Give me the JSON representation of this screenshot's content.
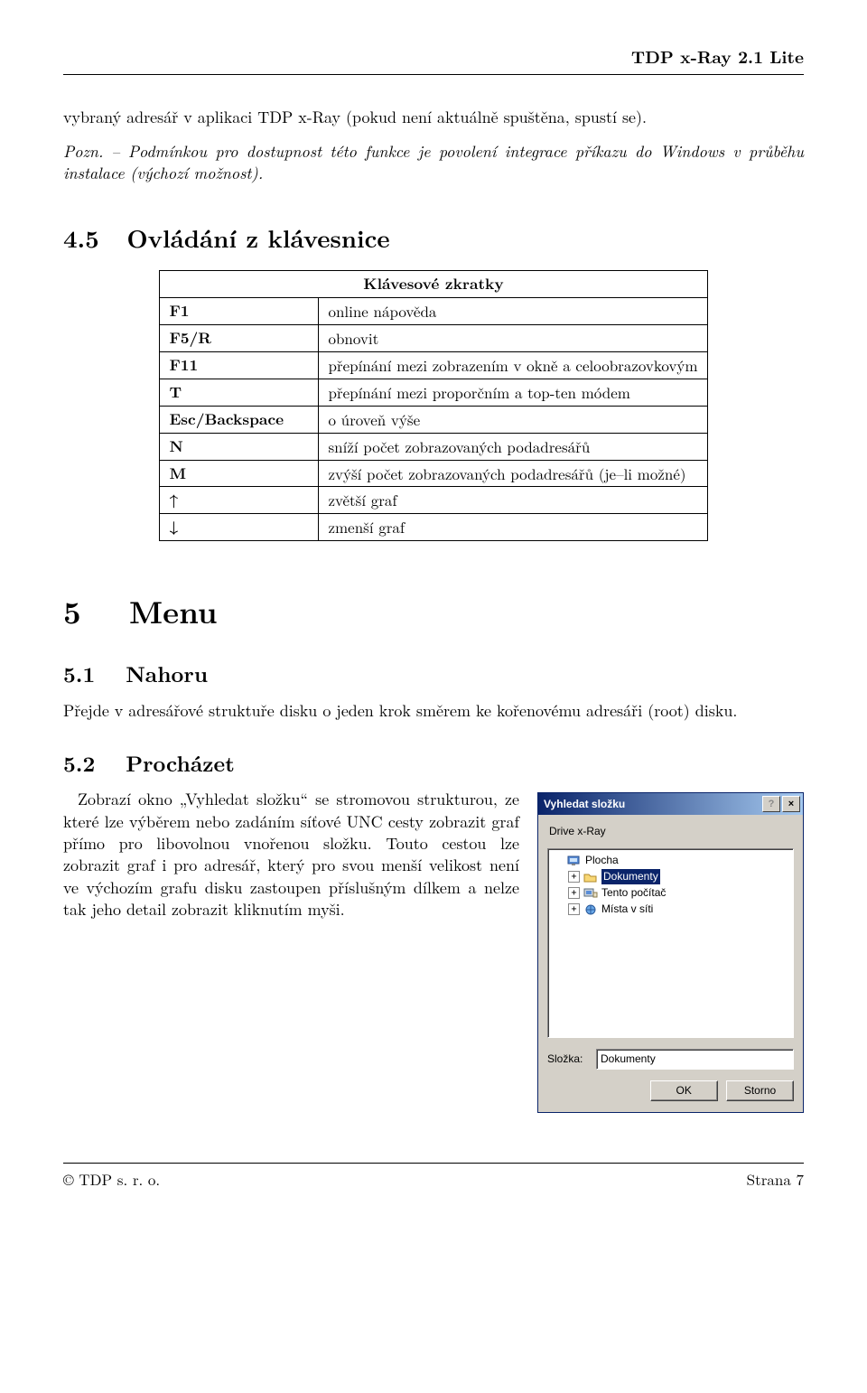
{
  "header": {
    "title": "TDP x-Ray 2.1 Lite"
  },
  "intro": {
    "para1": "vybraný adresář v aplikaci TDP x-Ray (pokud není aktuálně spuštěna, spustí se).",
    "pozn_label": "Pozn.",
    "pozn_body": "– Podmínkou pro dostupnost této funkce je povolení integrace příkazu do Windows v průběhu instalace (výchozí možnost)."
  },
  "s45": {
    "num": "4.5",
    "title": "Ovládání z klávesnice",
    "table_title": "Klávesové zkratky",
    "rows": [
      {
        "k": "F1",
        "v": "online nápověda"
      },
      {
        "k": "F5/R",
        "v": "obnovit"
      },
      {
        "k": "F11",
        "v": "přepínání mezi zobrazením v okně a celoobrazovkovým"
      },
      {
        "k": "T",
        "v": "přepínání mezi proporčním a top-ten módem"
      },
      {
        "k": "Esc/Backspace",
        "v": "o úroveň výše"
      },
      {
        "k": "N",
        "v": "sníží počet zobrazovaných podadresářů"
      },
      {
        "k": "M",
        "v": "zvýší počet zobrazovaných podadresářů (je–li možné)"
      },
      {
        "k": "↑",
        "v": "zvětší graf"
      },
      {
        "k": "↓",
        "v": "zmenší graf"
      }
    ]
  },
  "s5": {
    "num": "5",
    "title": "Menu"
  },
  "s51": {
    "num": "5.1",
    "title": "Nahoru",
    "body": "Přejde v adresářové struktuře disku o jeden krok směrem ke kořenovému adresáři (root) disku."
  },
  "s52": {
    "num": "5.2",
    "title": "Procházet",
    "body": "Zobrazí okno „Vyhledat složku“ se stromovou strukturou, ze které lze výběrem nebo zadáním síťové UNC cesty zobrazit graf přímo pro libovolnou vnořenou složku. Touto cestou lze zobrazit graf i pro adresář, který pro svou menší velikost není ve výchozím grafu disku zastoupen příslušným dílkem a nelze tak jeho detail zobrazit kliknutím myši."
  },
  "dialog": {
    "title": "Vyhledat složku",
    "help_glyph": "?",
    "close_glyph": "×",
    "subtitle": "Drive x-Ray",
    "tree": {
      "n0": "Plocha",
      "n1": "Dokumenty",
      "n2": "Tento počítač",
      "n3": "Místa v síti"
    },
    "folder_label": "Složka:",
    "folder_value": "Dokumenty",
    "ok": "OK",
    "cancel": "Storno"
  },
  "footer": {
    "left": "© TDP s. r. o.",
    "right": "Strana 7"
  }
}
